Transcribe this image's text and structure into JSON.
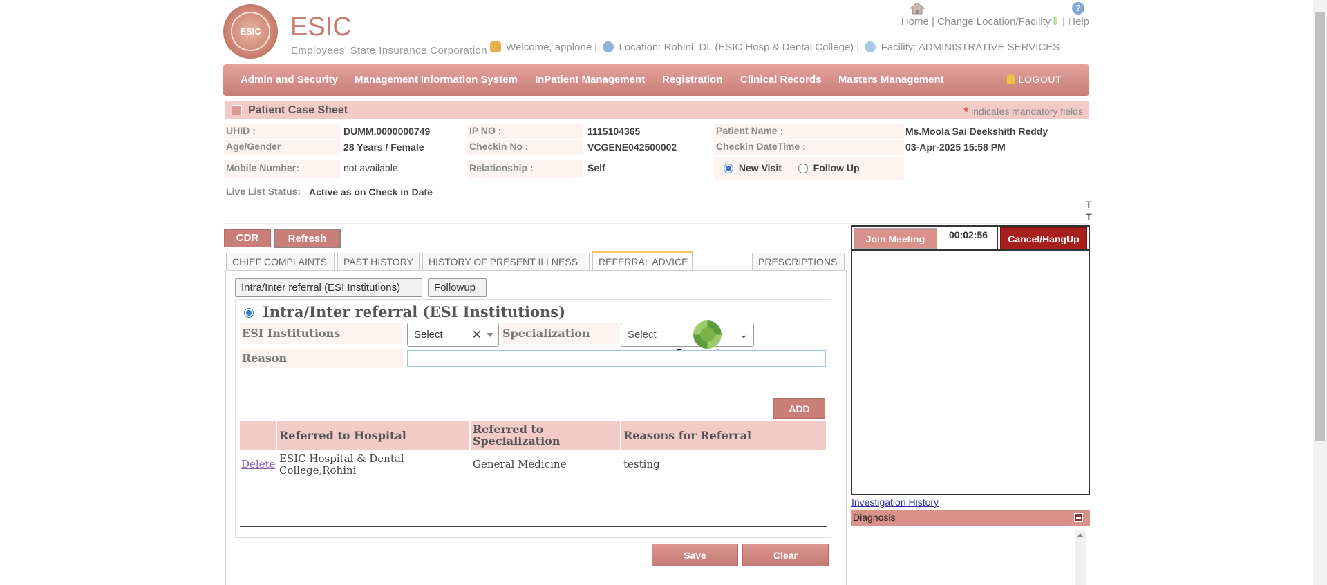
{
  "header": {
    "logo_text": "ESIC",
    "brand": "ESIC",
    "brand_subtitle": "Employees' State Insurance Corporation",
    "links": {
      "home": "Home",
      "sep1": "|",
      "change_location": "Change Location/Facility",
      "sep2": "|",
      "help": "Help"
    },
    "info": {
      "welcome": "Welcome, applone |",
      "location": "Location: Rohini, DL (ESIC Hosp & Dental College) |",
      "facility": "Facility: ADMINISTRATIVE SERVICES"
    }
  },
  "nav": {
    "items": [
      "Admin and Security",
      "Management Information System",
      "InPatient Management",
      "Registration",
      "Clinical Records",
      "Masters Management"
    ],
    "logout": "LOGOUT"
  },
  "case_sheet": {
    "title": "Patient Case Sheet",
    "mandatory_mark": "*",
    "mandatory_note": "indicates mandatory fields"
  },
  "patient": {
    "uhid_label": "UHID :",
    "uhid": "DUMM.0000000749",
    "ipno_label": "IP NO :",
    "ipno": "1115104365",
    "name_label": "Patient Name :",
    "name": "Ms.Moola Sai Deekshith Reddy",
    "age_label": "Age/Gender",
    "age": "28 Years / Female",
    "checkin_label": "Checkin No :",
    "checkin": "VCGENE042500002",
    "checkin_dt_label": "Checkin DateTime :",
    "checkin_dt": "03-Apr-2025 15:58 PM",
    "mobile_label": "Mobile Number:",
    "mobile": "not available",
    "relationship_label": "Relationship :",
    "relationship": "Self",
    "visit_new": "New Visit",
    "visit_follow": "Follow Up",
    "live_label": "Live List Status:",
    "live_value": "Active as on Check in Date",
    "edge_text_1": "T",
    "edge_text_2": "T"
  },
  "actions": {
    "cdr": "CDR",
    "refresh": "Refresh"
  },
  "tabs": [
    "CHIEF COMPLAINTS",
    "PAST HISTORY",
    "HISTORY OF PRESENT ILLNESS",
    "REFERRAL ADVICE",
    "PRESCRIPTIONS"
  ],
  "referral": {
    "sub_buttons": [
      "Intra/Inter referral (ESI Institutions)",
      "Followup"
    ],
    "section_title": "Intra/Inter referral (ESI Institutions)",
    "institutions_label": "ESI Institutions",
    "institutions_value": "Select",
    "specialization_label": "Specialization",
    "specialization_value": "Select",
    "reason_label": "Reason",
    "reason_value": "",
    "processing": "Processing..",
    "add": "ADD",
    "table": {
      "headers": [
        "Referred to Hospital",
        "Referred to Specialization",
        "Reasons for Referral"
      ],
      "rows": [
        {
          "action": "Delete",
          "hospital": "ESIC Hospital & Dental College,Rohini",
          "specialization": "General Medicine",
          "reason": "testing"
        }
      ]
    },
    "save": "Save",
    "clear": "Clear"
  },
  "meeting": {
    "join": "Join Meeting",
    "timer": "00:02:56",
    "hangup": "Cancel/HangUp",
    "investigation_link": "Investigation History",
    "diagnosis": "Diagnosis"
  },
  "colors": {
    "brand": "#c97c70",
    "nav": "#c77d77",
    "hangup": "#a8201e",
    "accent_radio": "#3b7bd6"
  }
}
